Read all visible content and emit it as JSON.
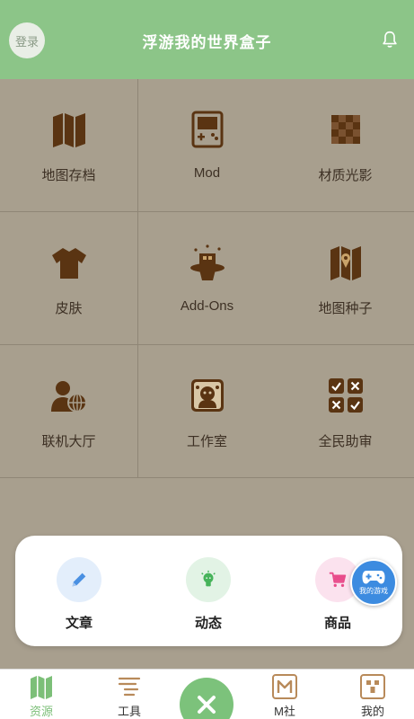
{
  "header": {
    "login_label": "登录",
    "title": "浮游我的世界盒子",
    "bell_icon": "bell-icon"
  },
  "grid": {
    "items": [
      {
        "label": "地图存档",
        "icon": "map-icon"
      },
      {
        "label": "Mod",
        "icon": "gameboy-icon"
      },
      {
        "label": "材质光影",
        "icon": "checker-icon"
      },
      {
        "label": "皮肤",
        "icon": "shirt-icon"
      },
      {
        "label": "Add-Ons",
        "icon": "magic-hat-icon"
      },
      {
        "label": "地图种子",
        "icon": "map-seed-icon"
      },
      {
        "label": "联机大厅",
        "icon": "multiplayer-icon"
      },
      {
        "label": "工作室",
        "icon": "studio-icon"
      },
      {
        "label": "全民助审",
        "icon": "review-icon"
      }
    ]
  },
  "card": {
    "items": [
      {
        "label": "文章",
        "icon": "pencil-icon",
        "color": "#4a90e2",
        "bg": "#e3eefb"
      },
      {
        "label": "动态",
        "icon": "bulb-icon",
        "color": "#46b35a",
        "bg": "#e2f3e5"
      },
      {
        "label": "商品",
        "icon": "cart-icon",
        "color": "#e84c8b",
        "bg": "#fbe2ee"
      }
    ]
  },
  "fab": {
    "label": "我的游戏",
    "icon": "gamepad-icon",
    "color": "#3c8be0"
  },
  "tabbar": {
    "items": [
      {
        "label": "资源",
        "icon": "map-icon",
        "active": true
      },
      {
        "label": "工具",
        "icon": "tools-icon",
        "active": false
      },
      {
        "label": "M社",
        "icon": "m-community-icon",
        "active": false
      },
      {
        "label": "我的",
        "icon": "profile-icon",
        "active": false
      }
    ],
    "center_icon": "close-icon"
  },
  "colors": {
    "header": "#8cc588",
    "background": "#a89f8e",
    "icon_brown": "#5a3412",
    "accent_green": "#7cc27b"
  }
}
